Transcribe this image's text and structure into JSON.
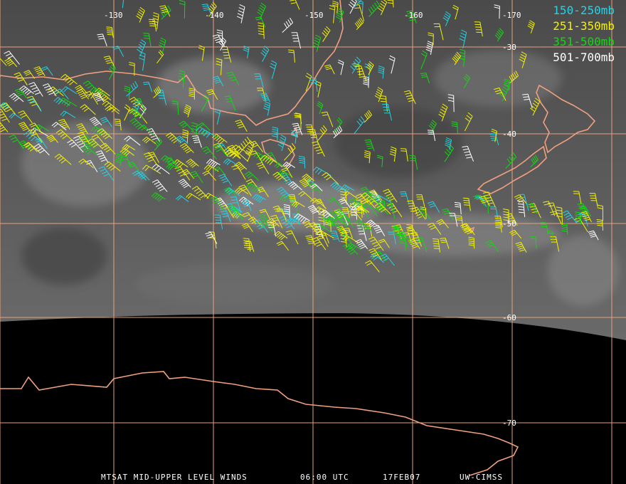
{
  "legend": [
    {
      "label": "150-250mb",
      "color": "#22d3e6"
    },
    {
      "label": "251-350mb",
      "color": "#f2f200"
    },
    {
      "label": "351-500mb",
      "color": "#12d812"
    },
    {
      "label": "501-700mb",
      "color": "#ffffff"
    }
  ],
  "longitude_labels": [
    "-130",
    "-140",
    "-150",
    "-160",
    "-170"
  ],
  "latitude_labels": [
    "-30",
    "-40",
    "-50",
    "-60",
    "-70"
  ],
  "footer": {
    "title": "MTSAT MID-UPPER LEVEL WINDS",
    "time": "06:00 UTC",
    "date": "17FEB07",
    "source": "UW-CIMSS"
  },
  "colors": {
    "grid": "#e9a07c",
    "coast": "#f0a080",
    "background": "#000000"
  }
}
